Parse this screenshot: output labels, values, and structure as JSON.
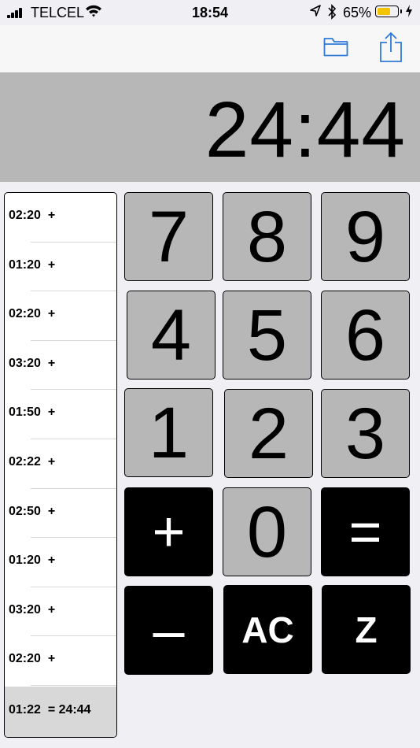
{
  "status_bar": {
    "carrier": "TELCEL",
    "time": "18:54",
    "battery_percent": "65%",
    "battery_level": 0.65,
    "battery_color": "#f5c400"
  },
  "nav_bar": {
    "accent_color": "#2f7ad9",
    "left_icon": "folder-icon",
    "right_icon": "share-icon"
  },
  "display": {
    "value": "24:44"
  },
  "tape": {
    "entries": [
      "02:20  +",
      "01:20  +",
      "02:20  +",
      "03:20  +",
      "01:50  +",
      "02:22  +",
      "02:50  +",
      "01:20  +",
      "03:20  +",
      "02:20  +"
    ],
    "total": "01:22  = 24:44"
  },
  "keypad": {
    "k7": "7",
    "k8": "8",
    "k9": "9",
    "k4": "4",
    "k5": "5",
    "k6": "6",
    "k1": "1",
    "k2": "2",
    "k3": "3",
    "plus": "+",
    "k0": "0",
    "equals": "=",
    "minus": "–",
    "clear": "AC",
    "z": "Z"
  }
}
